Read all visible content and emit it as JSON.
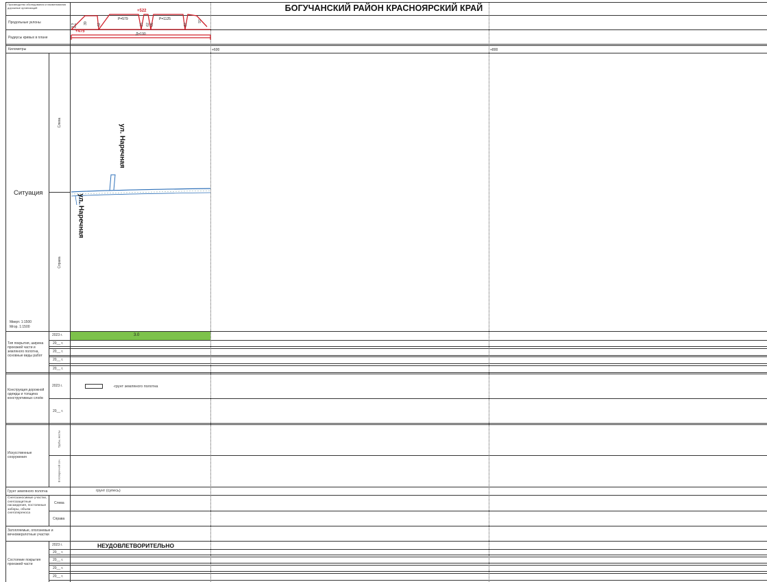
{
  "header": {
    "title": "БОГУЧАНСКИЙ РАЙОН КРАСНОЯРСКИЙ КРАЙ",
    "org_label": "Производство обследования и наименования дорожные организаций"
  },
  "rows": {
    "longitudinal_slopes": "Продольные уклоны",
    "curve_radii": "Радиусы кривых в плане",
    "kilometers": "Километры",
    "situation": "Ситуация",
    "left": "Слева",
    "right": "Справа",
    "scale_vert": "Мверт. 1:1500",
    "scale_hor": "Мгор.  1:1500",
    "surface_type": "Тип покрытия, ширина проезжей части и земляного полотна, основные виды работ",
    "pavement_construction": "Конструкция дорожной одежды и толщина конструктивных слоёв",
    "artificial_structures": "Искусственные сооружения",
    "struct_sub1": "Трубы, мосты",
    "struct_sub2": "В поперечной сеч.",
    "subgrade_soil": "Грунт земляного полотна",
    "snow_sections": "Снегозаносимые участки, снегозащитные насаждения, постоянные заборы, объем снегопереноса",
    "flooded": "Затопляемые, оползневые и вечномерзлотные участки",
    "surface_condition": "Состояние покрытия проезжей части"
  },
  "years": {
    "y2023": "2023 г.",
    "y20": "20__ г."
  },
  "profile": {
    "mark_top": "+522",
    "mark_bottom": "+475",
    "slope_p2": "Р-2",
    "slope_p2b": "Р-2",
    "slope_579": "Р=579",
    "slope_1125": "Р=1125",
    "slope_39": "39",
    "slope_62a": "62",
    "slope_15": "15",
    "slope_62b": "62",
    "slope_65": "65",
    "slope_62c": "62",
    "slope_97": "97",
    "radius": "Д=190"
  },
  "km": {
    "mark1": "+600",
    "mark2": "+800"
  },
  "situation_map": {
    "street_top": "ул. Наречная",
    "street_bottom": "ул. Наречная"
  },
  "values": {
    "surface_width": "3.0",
    "soil_legend": "-грунт земляного полотна",
    "soil_type": "грунт (супесь)",
    "condition": "НЕУДОВЛЕТВОРИТЕЛЬНО"
  },
  "colors": {
    "red": "#d0202a",
    "green": "#7dc24b",
    "road_blue": "#2c6fb8"
  }
}
